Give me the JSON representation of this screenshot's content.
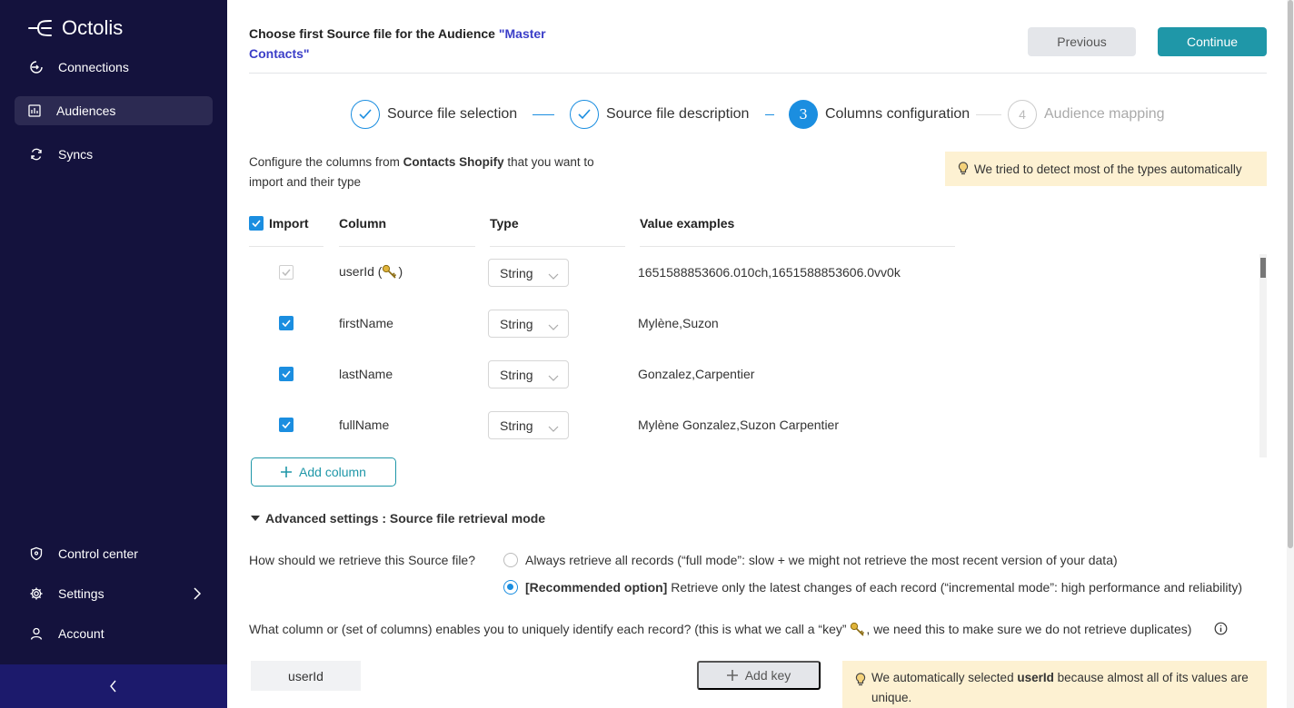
{
  "app": {
    "name": "Octolis"
  },
  "sidebar": {
    "items": [
      {
        "label": "Connections",
        "icon": "connections-icon"
      },
      {
        "label": "Audiences",
        "icon": "audiences-icon",
        "active": true
      },
      {
        "label": "Syncs",
        "icon": "syncs-icon"
      }
    ],
    "bottom_items": [
      {
        "label": "Control center",
        "icon": "shield-icon"
      },
      {
        "label": "Settings",
        "icon": "gear-icon"
      },
      {
        "label": "Account",
        "icon": "user-icon"
      }
    ],
    "collapse_icon": "chevron-left-icon"
  },
  "header": {
    "title_prefix": "Choose first Source file for the Audience ",
    "title_accent": "\"Master Contacts\"",
    "previous_label": "Previous",
    "continue_label": "Continue"
  },
  "stepper": {
    "steps": [
      {
        "label": "Source file selection",
        "state": "done"
      },
      {
        "label": "Source file description",
        "state": "done"
      },
      {
        "number": "3",
        "label": "Columns configuration",
        "state": "current"
      },
      {
        "number": "4",
        "label": "Audience mapping",
        "state": "todo"
      }
    ]
  },
  "intro": {
    "before": "Configure the columns from ",
    "source": "Contacts Shopify",
    "after": " that you want to import and their type"
  },
  "tip_types": "We tried to detect most of the types automatically",
  "table": {
    "headers": {
      "import": "Import",
      "column": "Column",
      "type": "Type",
      "examples": "Value examples"
    },
    "rows": [
      {
        "column": "userId (",
        "column_suffix": ")",
        "type": "String",
        "examples": "1651588853606.010ch,1651588853606.0vv0k",
        "checked": true,
        "disabled": true,
        "is_key": true
      },
      {
        "column": "firstName",
        "type": "String",
        "examples": "Mylène,Suzon",
        "checked": true
      },
      {
        "column": "lastName",
        "type": "String",
        "examples": "Gonzalez,Carpentier",
        "checked": true
      },
      {
        "column": "fullName",
        "type": "String",
        "examples": "Mylène Gonzalez,Suzon Carpentier",
        "checked": true
      }
    ]
  },
  "add_column_label": "Add column",
  "advanced": {
    "title": "Advanced settings : Source file retrieval mode",
    "question": "How should we retrieve this Source file?",
    "options": [
      {
        "bold": "",
        "text": "Always retrieve all records (“full mode”: slow + we might not retrieve the most recent version of your data)",
        "selected": false
      },
      {
        "bold": "[Recommended option]",
        "text": " Retrieve only the latest changes of each record (“incremental mode”: high performance and reliability)",
        "selected": true
      }
    ],
    "key_question_before": "What column or (set of columns) enables you to uniquely identify each record? (this is what we call a “key” ",
    "key_question_after": ", we need this to make sure we do not retrieve duplicates)",
    "key_chip": "userId",
    "add_key_label": "Add key",
    "tip_key_before": "We automatically selected ",
    "tip_key_bold": "userId",
    "tip_key_after": " because almost all of its values are unique."
  },
  "colors": {
    "sidebar": "#14123d",
    "accent": "#1f97a8",
    "blue": "#1b8ee0",
    "tip": "#fdf1d2"
  }
}
